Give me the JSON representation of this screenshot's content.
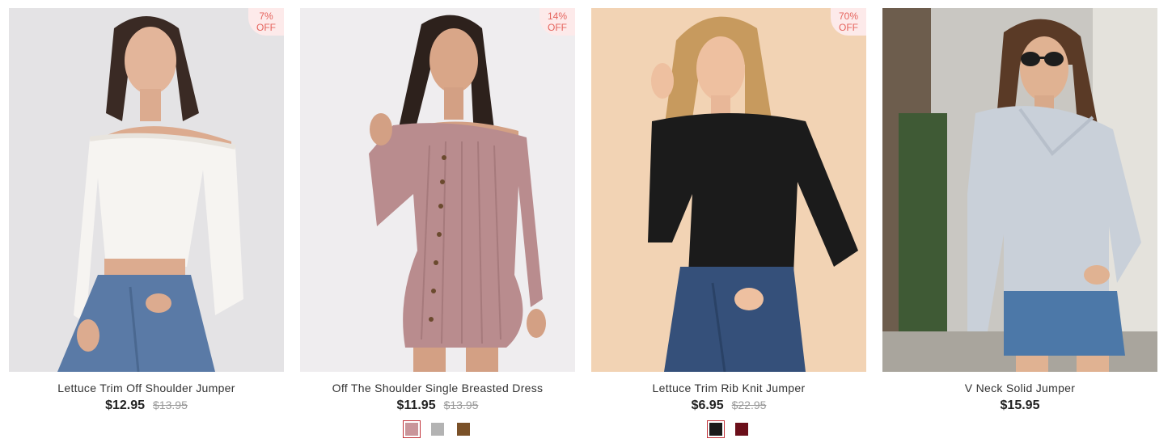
{
  "products": [
    {
      "name": "Lettuce Trim Off Shoulder Jumper",
      "price": "$12.95",
      "old_price": "$13.95",
      "badge_pct": "7%",
      "badge_off": "OFF",
      "swatches": []
    },
    {
      "name": "Off The Shoulder Single Breasted Dress",
      "price": "$11.95",
      "old_price": "$13.95",
      "badge_pct": "14%",
      "badge_off": "OFF",
      "swatches": [
        "#c9959a",
        "#b3b3b3",
        "#7a5128"
      ],
      "selected_swatch": 0
    },
    {
      "name": "Lettuce Trim Rib Knit Jumper",
      "price": "$6.95",
      "old_price": "$22.95",
      "badge_pct": "70%",
      "badge_off": "OFF",
      "swatches": [
        "#1a1a1a",
        "#6b0f1a"
      ],
      "selected_swatch": 0
    },
    {
      "name": "V Neck Solid Jumper",
      "price": "$15.95",
      "old_price": "",
      "swatches": []
    }
  ],
  "colors": {
    "badge_bg": "#fdeaea",
    "badge_text": "#e5645d",
    "selected_border": "#c2333a"
  }
}
